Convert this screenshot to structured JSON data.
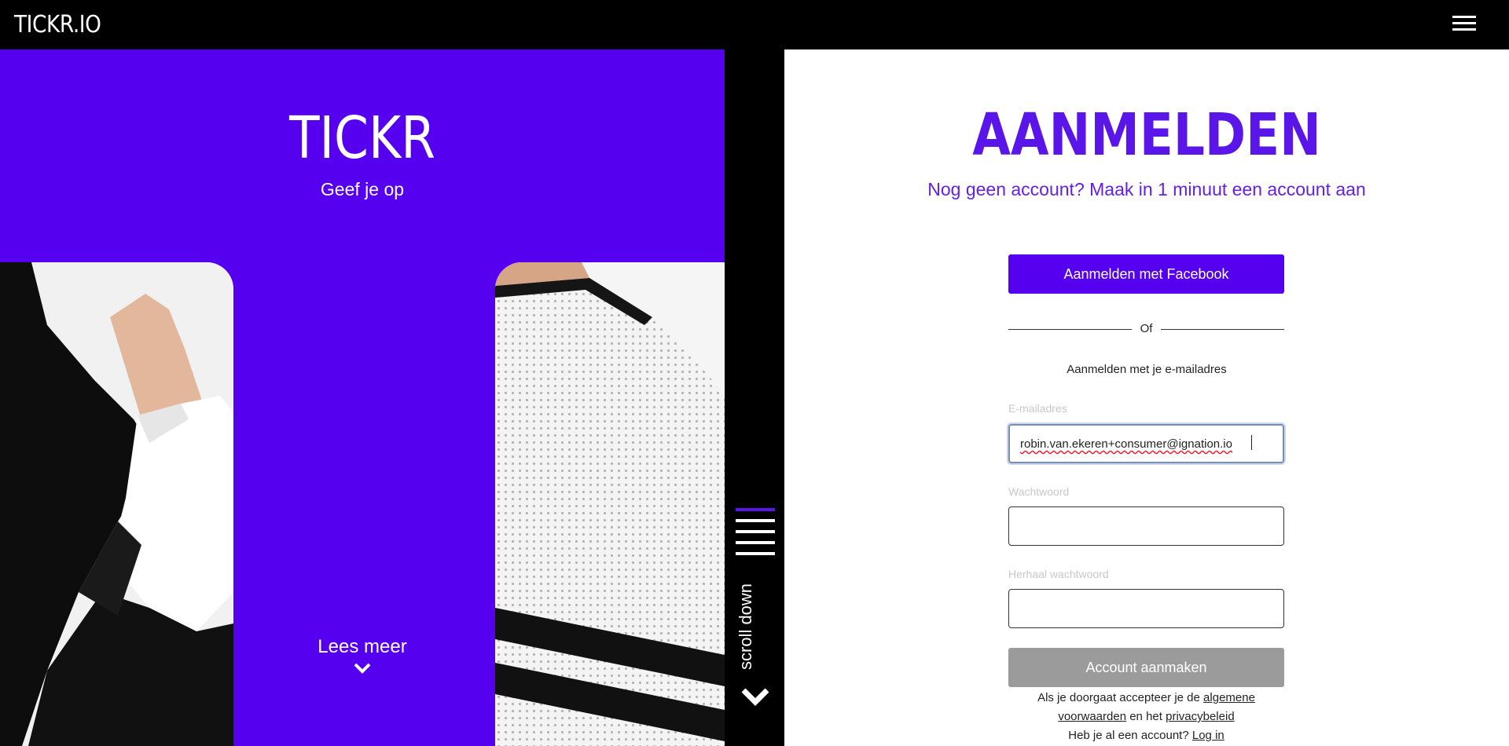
{
  "header": {
    "logo": "TICKR.IO",
    "menu_icon": "hamburger-menu-icon"
  },
  "hero": {
    "title": "TICKR",
    "subtitle": "Geef je op",
    "read_more": "Lees meer",
    "read_more_icon": "chevron-down-icon"
  },
  "scroll": {
    "label": "scroll down",
    "icon": "chevron-down-icon"
  },
  "form": {
    "title": "AANMELDEN",
    "subtitle": "Nog geen account? Maak in 1 minuut een account aan",
    "facebook_button": "Aanmelden met Facebook",
    "divider": "Of",
    "email_heading": "Aanmelden met je e-mailadres",
    "email_label": "E-mailadres",
    "email_value": "robin.van.ekeren+consumer@ignation.io",
    "password_label": "Wachtwoord",
    "password_value": "",
    "repeat_label": "Herhaal wachtwoord",
    "repeat_value": "",
    "create_button": "Account aanmaken",
    "terms_prefix": "Als je doorgaat accepteer je de",
    "terms_link": "algemene voorwaarden",
    "terms_middle": "en het",
    "privacy_link": "privacybeleid",
    "login_prefix": "Heb je al een account?",
    "login_link": "Log in"
  },
  "colors": {
    "brand_purple": "#5500ee",
    "text_purple": "#5a16e8",
    "disabled_grey": "#9b9b9b"
  }
}
